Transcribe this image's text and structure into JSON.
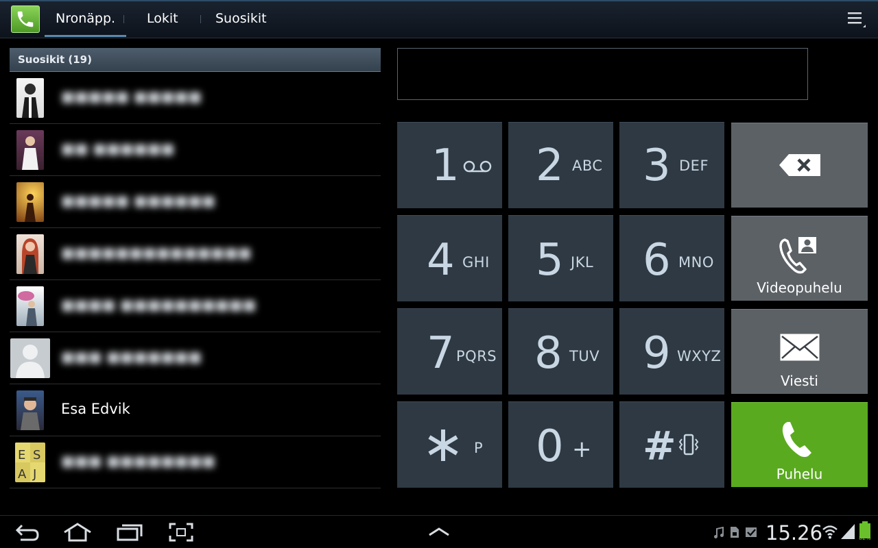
{
  "tabs": [
    {
      "label": "Nronäpp.",
      "active": true
    },
    {
      "label": "Lokit",
      "active": false
    },
    {
      "label": "Suosikit",
      "active": false
    }
  ],
  "favorites": {
    "header": "Suosikit (19)",
    "contacts": [
      {
        "name": "",
        "photo_color": "#e8e8e8",
        "blurred": true
      },
      {
        "name": "",
        "photo_color": "#7a4a6a",
        "blurred": true
      },
      {
        "name": "",
        "photo_color": "#c88a20",
        "blurred": true
      },
      {
        "name": "",
        "photo_color": "#c05a3a",
        "blurred": true
      },
      {
        "name": "",
        "photo_color": "#8a9aa8",
        "blurred": true
      },
      {
        "name": "",
        "photo_color": "#c7ccd1",
        "blurred": true,
        "default_avatar": true
      },
      {
        "name": "Esa Edvik",
        "photo_color": "#4a4a5a",
        "blurred": false
      },
      {
        "name": "",
        "photo_color": "#c8b84a",
        "blurred": true
      }
    ]
  },
  "keypad": [
    {
      "digit": "1",
      "letters": "",
      "icon": "voicemail-icon"
    },
    {
      "digit": "2",
      "letters": "ABC"
    },
    {
      "digit": "3",
      "letters": "DEF"
    },
    {
      "digit": "4",
      "letters": "GHI"
    },
    {
      "digit": "5",
      "letters": "JKL"
    },
    {
      "digit": "6",
      "letters": "MNO"
    },
    {
      "digit": "7",
      "letters": "PQRS"
    },
    {
      "digit": "8",
      "letters": "TUV"
    },
    {
      "digit": "9",
      "letters": "WXYZ"
    },
    {
      "digit": "*",
      "letters": "P"
    },
    {
      "digit": "0",
      "letters": "+"
    },
    {
      "digit": "#",
      "letters": "",
      "icon": "vibrate-icon"
    }
  ],
  "actions": {
    "backspace_icon": "backspace-icon",
    "video_call_label": "Videopuhelu",
    "message_label": "Viesti",
    "call_label": "Puhelu"
  },
  "status": {
    "time": "15.26",
    "battery_percent": "82%"
  },
  "colors": {
    "call_green": "#5aaa1f",
    "key_bg": "#2f3943",
    "action_key_bg": "#5c6166"
  }
}
